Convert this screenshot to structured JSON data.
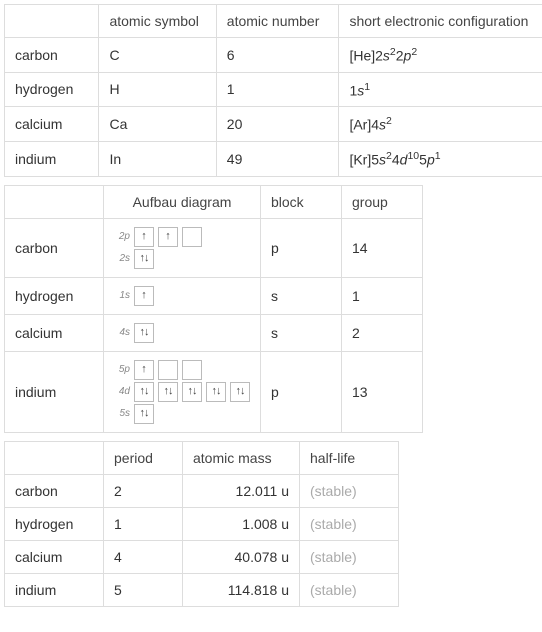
{
  "table1": {
    "headers": {
      "col1": "",
      "col2": "atomic symbol",
      "col3": "atomic number",
      "col4": "short electronic configuration"
    },
    "rows": [
      {
        "name": "carbon",
        "symbol": "C",
        "number": "6",
        "config_prefix": "[He]2",
        "config_s_exp": "2",
        "config_mid": "2",
        "config_p_exp": "2",
        "config_suffix": ""
      },
      {
        "name": "hydrogen",
        "symbol": "H",
        "number": "1",
        "config_prefix": "1",
        "config_s_exp": "1",
        "config_mid": "",
        "config_p_exp": "",
        "config_suffix": ""
      },
      {
        "name": "calcium",
        "symbol": "Ca",
        "number": "20",
        "config_prefix": "[Ar]4",
        "config_s_exp": "2",
        "config_mid": "",
        "config_p_exp": "",
        "config_suffix": ""
      },
      {
        "name": "indium",
        "symbol": "In",
        "number": "49",
        "config_prefix": "[Kr]5",
        "config_s_exp": "2",
        "config_mid": "4",
        "config_d_exp": "10",
        "config_after_d": "5",
        "config_p_exp": "1"
      }
    ]
  },
  "table2": {
    "headers": {
      "col1": "",
      "col2": "Aufbau diagram",
      "col3": "block",
      "col4": "group"
    },
    "rows": [
      {
        "name": "carbon",
        "block": "p",
        "group": "14",
        "subshells": [
          {
            "label": "2p",
            "orbitals": [
              "↑",
              "↑",
              ""
            ]
          },
          {
            "label": "2s",
            "orbitals": [
              "↑↓"
            ]
          }
        ]
      },
      {
        "name": "hydrogen",
        "block": "s",
        "group": "1",
        "subshells": [
          {
            "label": "1s",
            "orbitals": [
              "↑"
            ]
          }
        ]
      },
      {
        "name": "calcium",
        "block": "s",
        "group": "2",
        "subshells": [
          {
            "label": "4s",
            "orbitals": [
              "↑↓"
            ]
          }
        ]
      },
      {
        "name": "indium",
        "block": "p",
        "group": "13",
        "subshells": [
          {
            "label": "5p",
            "orbitals": [
              "↑",
              "",
              ""
            ]
          },
          {
            "label": "4d",
            "orbitals": [
              "↑↓",
              "↑↓",
              "↑↓",
              "↑↓",
              "↑↓"
            ]
          },
          {
            "label": "5s",
            "orbitals": [
              "↑↓"
            ]
          }
        ]
      }
    ]
  },
  "table3": {
    "headers": {
      "col1": "",
      "col2": "period",
      "col3": "atomic mass",
      "col4": "half-life"
    },
    "rows": [
      {
        "name": "carbon",
        "period": "2",
        "mass": "12.011 u",
        "half": "(stable)"
      },
      {
        "name": "hydrogen",
        "period": "1",
        "mass": "1.008 u",
        "half": "(stable)"
      },
      {
        "name": "calcium",
        "period": "4",
        "mass": "40.078 u",
        "half": "(stable)"
      },
      {
        "name": "indium",
        "period": "5",
        "mass": "114.818 u",
        "half": "(stable)"
      }
    ]
  }
}
